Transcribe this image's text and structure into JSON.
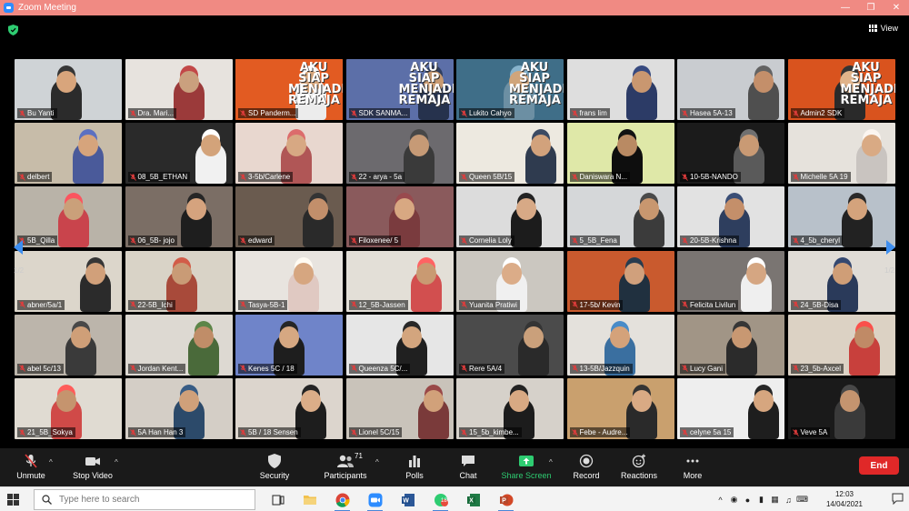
{
  "window": {
    "title": "Zoom Meeting"
  },
  "view_button": {
    "label": "View"
  },
  "pager": {
    "left": "1/2",
    "right": "1/2"
  },
  "participants": [
    {
      "name": "Bu Yanti",
      "bg": "#cfd3d6",
      "skin": "#d8a57c",
      "shirt": "#2b2b2b"
    },
    {
      "name": "Dra. Mari...",
      "bg": "#e7e3de",
      "skin": "#caa07e",
      "shirt": "#9b3a3a"
    },
    {
      "name": "SD Panderm...",
      "bg": "#e25b22",
      "skin": "#d4a47a",
      "shirt": "#ececec",
      "banner": "AKU SIAP MENJADI REMAJA",
      "active": true
    },
    {
      "name": "SDK SANMA...",
      "bg": "#5c6fa8",
      "skin": "#c79a72",
      "shirt": "#26324d",
      "banner": "AKU SIAP MENJADI REMAJA"
    },
    {
      "name": "Lukito Cahyo",
      "bg": "#3f6e88",
      "skin": "#d0a57b",
      "shirt": "#6c8fa3",
      "banner": "AKU SIAP MENJADI REMAJA"
    },
    {
      "name": "frans lim",
      "bg": "#dedede",
      "skin": "#c99770",
      "shirt": "#2c3b66"
    },
    {
      "name": "Hasea 5A-13",
      "bg": "#c9ccd0",
      "skin": "#c48f6a",
      "shirt": "#4f4f4f"
    },
    {
      "name": "Admin2 SDK",
      "bg": "#d9531e",
      "skin": "#e0b38a",
      "shirt": "#2a2a2a",
      "banner": "AKU SIAP MENJADI REMAJA"
    },
    {
      "name": "delbert",
      "bg": "#c7bca9",
      "skin": "#d6a47c",
      "shirt": "#4a5a9a"
    },
    {
      "name": "08_5B_ETHAN",
      "bg": "#2a2a2a",
      "skin": "#d3a37a",
      "shirt": "#f1f1f1"
    },
    {
      "name": "3-5b/Carlene",
      "bg": "#e8d7cf",
      "skin": "#d7a883",
      "shirt": "#b05656"
    },
    {
      "name": "22 - arya - 5a",
      "bg": "#6c6a6e",
      "skin": "#c69a76",
      "shirt": "#3a3a3a"
    },
    {
      "name": "Queen 5B/15",
      "bg": "#ede9e0",
      "skin": "#d2a27c",
      "shirt": "#2f3b4f"
    },
    {
      "name": "Daniswara N...",
      "bg": "#dfe8a8",
      "skin": "#b98a63",
      "shirt": "#0e0e0e"
    },
    {
      "name": "10-5B-NANDO",
      "bg": "#1b1b1b",
      "skin": "#c99a74",
      "shirt": "#5a5a5a"
    },
    {
      "name": "Michelle 5A 19",
      "bg": "#e6e2dc",
      "skin": "#d9aa84",
      "shirt": "#c9c4c0"
    },
    {
      "name": "5B_Qilla",
      "bg": "#b9b3a8",
      "skin": "#caa07a",
      "shirt": "#c9444c"
    },
    {
      "name": "06_5B- jojo",
      "bg": "#7b6e65",
      "skin": "#d5a37e",
      "shirt": "#1e1e1e"
    },
    {
      "name": "edward",
      "bg": "#6a5b4f",
      "skin": "#c28f6b",
      "shirt": "#2a2a2a"
    },
    {
      "name": "Filoxenee/ 5",
      "bg": "#8a5a5c",
      "skin": "#d8a882",
      "shirt": "#7a3b3e"
    },
    {
      "name": "Cornelia Loly",
      "bg": "#dcdcdc",
      "skin": "#d7a986",
      "shirt": "#1c1c1c"
    },
    {
      "name": "5_5B_Fena",
      "bg": "#d5d7d9",
      "skin": "#c8976f",
      "shirt": "#3b3b3b"
    },
    {
      "name": "20-5B-Krishna",
      "bg": "#e2e2e2",
      "skin": "#c48f6a",
      "shirt": "#2e3e5e"
    },
    {
      "name": "4_5b_cheryl",
      "bg": "#b8c1ca",
      "skin": "#d4a37c",
      "shirt": "#222"
    },
    {
      "name": "abner/5a/1",
      "bg": "#dcd6cb",
      "skin": "#d1a07a",
      "shirt": "#2b2b2b"
    },
    {
      "name": "22-5B_Ichi",
      "bg": "#d9d3c7",
      "skin": "#c99b76",
      "shirt": "#a84a3a"
    },
    {
      "name": "Tasya-5B-1",
      "bg": "#e8e4df",
      "skin": "#d6a680",
      "shirt": "#e0c9c2"
    },
    {
      "name": "12_5B-Jassen",
      "bg": "#e3dfd7",
      "skin": "#c99a72",
      "shirt": "#d24f4f"
    },
    {
      "name": "Yuanita Pratiwi",
      "bg": "#cbc7c0",
      "skin": "#dbac88",
      "shirt": "#f0f0f0"
    },
    {
      "name": "17-5b/ Kevin",
      "bg": "#c95a2e",
      "skin": "#d0a07c",
      "shirt": "#20303f"
    },
    {
      "name": "Felicita Livilun",
      "bg": "#7a7572",
      "skin": "#d5a682",
      "shirt": "#efefef"
    },
    {
      "name": "24_5B-Disa",
      "bg": "#e0dcd6",
      "skin": "#cf9e77",
      "shirt": "#2a3a5a"
    },
    {
      "name": "abel 5c/13",
      "bg": "#bcb5ab",
      "skin": "#cf9f78",
      "shirt": "#3a3a3a"
    },
    {
      "name": "Jordan Kent...",
      "bg": "#ddd9d2",
      "skin": "#c08d68",
      "shirt": "#4a6a3a"
    },
    {
      "name": "Kenes 5C / 18",
      "bg": "#6f84c9",
      "skin": "#d6a882",
      "shirt": "#1e1e1e"
    },
    {
      "name": "Queenza 5C/...",
      "bg": "#e6e6e6",
      "skin": "#d3a57e",
      "shirt": "#202020"
    },
    {
      "name": "Rere 5A/4",
      "bg": "#4b4b4b",
      "skin": "#caa07b",
      "shirt": "#2a2a2a"
    },
    {
      "name": "13-5B/Jazzquin",
      "bg": "#e4e1dc",
      "skin": "#d4a27a",
      "shirt": "#3a6fa0"
    },
    {
      "name": "Lucy Gani",
      "bg": "#a19586",
      "skin": "#c89872",
      "shirt": "#2b2b2b"
    },
    {
      "name": "23_5b-Axcel",
      "bg": "#dcd2c4",
      "skin": "#c08a66",
      "shirt": "#c8403c"
    },
    {
      "name": "21_5B_Sokya",
      "bg": "#e0dbd2",
      "skin": "#c5946e",
      "shirt": "#d04a48"
    },
    {
      "name": "5A Han Han 3",
      "bg": "#d4cec6",
      "skin": "#cfa07a",
      "shirt": "#2c4a6a"
    },
    {
      "name": "5B / 18 Sensen",
      "bg": "#dcd5cd",
      "skin": "#dbad88",
      "shirt": "#1d1d1d"
    },
    {
      "name": "Lionel 5C/15",
      "bg": "#c9c3ba",
      "skin": "#d1a17a",
      "shirt": "#7a3a3a"
    },
    {
      "name": "15_5b_kimbe...",
      "bg": "#d6d1ca",
      "skin": "#d8a983",
      "shirt": "#1c1c1c"
    },
    {
      "name": "Febe - Audre...",
      "bg": "#c9a06e",
      "skin": "#d9aa84",
      "shirt": "#2a2a2a"
    },
    {
      "name": "celyne 5a 15",
      "bg": "#eeeeee",
      "skin": "#d6a67f",
      "shirt": "#1e1e1e"
    },
    {
      "name": "Veve 5A",
      "bg": "#1a1a1a",
      "skin": "#c4946f",
      "shirt": "#3a3a3a"
    }
  ],
  "toolbar": {
    "unmute": "Unmute",
    "stop_video": "Stop Video",
    "security": "Security",
    "participants": "Participants",
    "participants_count": "71",
    "polls": "Polls",
    "chat": "Chat",
    "share_screen": "Share Screen",
    "record": "Record",
    "reactions": "Reactions",
    "more": "More",
    "end": "End"
  },
  "taskbar": {
    "search_placeholder": "Type here to search",
    "time": "12:03",
    "date": "14/04/2021",
    "notifications_count": "18"
  },
  "colors": {
    "title_bar": "#f08a83",
    "end_button": "#e02828",
    "share_screen": "#2ecc71",
    "active_speaker": "#f7e84d"
  }
}
